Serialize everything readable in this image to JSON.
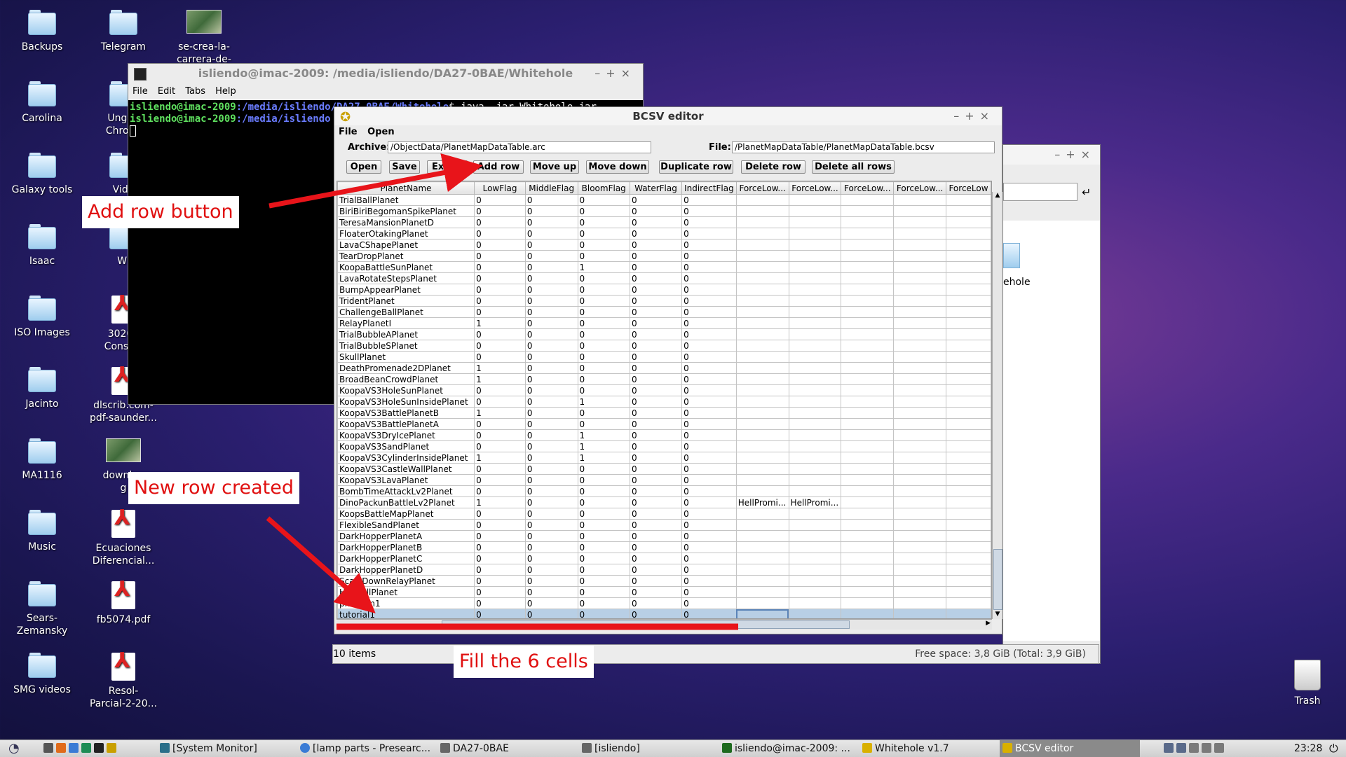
{
  "desktop": {
    "icons_col1": [
      {
        "label": "Backups",
        "kind": "folder"
      },
      {
        "label": "Carolina",
        "kind": "folder"
      },
      {
        "label": "Galaxy tools",
        "kind": "folder"
      },
      {
        "label": "Isaac",
        "kind": "folder"
      },
      {
        "label": "ISO Images",
        "kind": "folder"
      },
      {
        "label": "Jacinto",
        "kind": "folder"
      },
      {
        "label": "MA1116",
        "kind": "folder"
      },
      {
        "label": "Music",
        "kind": "folder"
      },
      {
        "label": "Sears-\nZemansky",
        "kind": "folder"
      },
      {
        "label": "SMG videos",
        "kind": "folder"
      }
    ],
    "icons_col2": [
      {
        "label": "Telegram",
        "kind": "folder"
      },
      {
        "label": "Ungoo\nChromi",
        "kind": "folder"
      },
      {
        "label": "Vide",
        "kind": "folder"
      },
      {
        "label": "Wi",
        "kind": "folder"
      },
      {
        "label": "30209\nConstru",
        "kind": "pdf"
      },
      {
        "label": "dlscrib.com-\npdf-saunder...",
        "kind": "pdf"
      },
      {
        "label": "downloa\ng",
        "kind": "image"
      },
      {
        "label": "Ecuaciones\nDiferencial...",
        "kind": "pdf"
      },
      {
        "label": "fb5074.pdf",
        "kind": "pdf"
      },
      {
        "label": "Resol-\nParcial-2-20...",
        "kind": "pdf"
      }
    ],
    "icons_col3": [
      {
        "label": "se-crea-la-\ncarrera-de-",
        "kind": "image"
      }
    ],
    "trash_label": "Trash"
  },
  "terminal": {
    "title": "isliendo@imac-2009: /media/isliendo/DA27-0BAE/Whitehole",
    "menu": [
      "File",
      "Edit",
      "Tabs",
      "Help"
    ],
    "line1_user": "isliendo@imac-2009",
    "line1_path": ":/media/isliendo/DA27-0BAE/Whitehole",
    "line1_cmd": "$ java -jar Whitehole.jar",
    "line2_user": "isliendo@imac-2009",
    "line2_path": ":/media/isliendo"
  },
  "filemanager": {
    "folder_label": "ehole",
    "status_left": "10 items",
    "status_right": "Free space: 3,8 GiB (Total: 3,9 GiB)"
  },
  "bcsv": {
    "title": "BCSV editor",
    "menu": [
      "File",
      "Open"
    ],
    "archive_label": "Archive:",
    "archive_value": "/ObjectData/PlanetMapDataTable.arc",
    "file_label": "File:",
    "file_value": "/PlanetMapDataTable/PlanetMapDataTable.bcsv",
    "buttons": {
      "open": "Open",
      "save": "Save",
      "export": "Exp",
      "add_row": "Add row",
      "move_up": "Move up",
      "move_down": "Move down",
      "duplicate_row": "Duplicate row",
      "delete_row": "Delete row",
      "delete_all_rows": "Delete all rows"
    },
    "columns": [
      "PlanetName",
      "LowFlag",
      "MiddleFlag",
      "BloomFlag",
      "WaterFlag",
      "IndirectFlag",
      "ForceLow...",
      "ForceLow...",
      "ForceLow...",
      "ForceLow...",
      "ForceLow"
    ],
    "rows": [
      [
        "TrialBallPlanet",
        "0",
        "0",
        "0",
        "0",
        "0",
        "",
        "",
        "",
        "",
        ""
      ],
      [
        "BiriBiriBegomanSpikePlanet",
        "0",
        "0",
        "0",
        "0",
        "0",
        "",
        "",
        "",
        "",
        ""
      ],
      [
        "TeresaMansionPlanetD",
        "0",
        "0",
        "0",
        "0",
        "0",
        "",
        "",
        "",
        "",
        ""
      ],
      [
        "FloaterOtakingPlanet",
        "0",
        "0",
        "0",
        "0",
        "0",
        "",
        "",
        "",
        "",
        ""
      ],
      [
        "LavaCShapePlanet",
        "0",
        "0",
        "0",
        "0",
        "0",
        "",
        "",
        "",
        "",
        ""
      ],
      [
        "TearDropPlanet",
        "0",
        "0",
        "0",
        "0",
        "0",
        "",
        "",
        "",
        "",
        ""
      ],
      [
        "KoopaBattleSunPlanet",
        "0",
        "0",
        "1",
        "0",
        "0",
        "",
        "",
        "",
        "",
        ""
      ],
      [
        "LavaRotateStepsPlanet",
        "0",
        "0",
        "0",
        "0",
        "0",
        "",
        "",
        "",
        "",
        ""
      ],
      [
        "BumpAppearPlanet",
        "0",
        "0",
        "0",
        "0",
        "0",
        "",
        "",
        "",
        "",
        ""
      ],
      [
        "TridentPlanet",
        "0",
        "0",
        "0",
        "0",
        "0",
        "",
        "",
        "",
        "",
        ""
      ],
      [
        "ChallengeBallPlanet",
        "0",
        "0",
        "0",
        "0",
        "0",
        "",
        "",
        "",
        "",
        ""
      ],
      [
        "RelayPlanetI",
        "1",
        "0",
        "0",
        "0",
        "0",
        "",
        "",
        "",
        "",
        ""
      ],
      [
        "TrialBubbleAPlanet",
        "0",
        "0",
        "0",
        "0",
        "0",
        "",
        "",
        "",
        "",
        ""
      ],
      [
        "TrialBubbleSPlanet",
        "0",
        "0",
        "0",
        "0",
        "0",
        "",
        "",
        "",
        "",
        ""
      ],
      [
        "SkullPlanet",
        "0",
        "0",
        "0",
        "0",
        "0",
        "",
        "",
        "",
        "",
        ""
      ],
      [
        "DeathPromenade2DPlanet",
        "1",
        "0",
        "0",
        "0",
        "0",
        "",
        "",
        "",
        "",
        ""
      ],
      [
        "BroadBeanCrowdPlanet",
        "1",
        "0",
        "0",
        "0",
        "0",
        "",
        "",
        "",
        "",
        ""
      ],
      [
        "KoopaVS3HoleSunPlanet",
        "0",
        "0",
        "0",
        "0",
        "0",
        "",
        "",
        "",
        "",
        ""
      ],
      [
        "KoopaVS3HoleSunInsidePlanet",
        "0",
        "0",
        "1",
        "0",
        "0",
        "",
        "",
        "",
        "",
        ""
      ],
      [
        "KoopaVS3BattlePlanetB",
        "1",
        "0",
        "0",
        "0",
        "0",
        "",
        "",
        "",
        "",
        ""
      ],
      [
        "KoopaVS3BattlePlanetA",
        "0",
        "0",
        "0",
        "0",
        "0",
        "",
        "",
        "",
        "",
        ""
      ],
      [
        "KoopaVS3DryIcePlanet",
        "0",
        "0",
        "1",
        "0",
        "0",
        "",
        "",
        "",
        "",
        ""
      ],
      [
        "KoopaVS3SandPlanet",
        "0",
        "0",
        "1",
        "0",
        "0",
        "",
        "",
        "",
        "",
        ""
      ],
      [
        "KoopaVS3CylinderInsidePlanet",
        "1",
        "0",
        "1",
        "0",
        "0",
        "",
        "",
        "",
        "",
        ""
      ],
      [
        "KoopaVS3CastleWallPlanet",
        "0",
        "0",
        "0",
        "0",
        "0",
        "",
        "",
        "",
        "",
        ""
      ],
      [
        "KoopaVS3LavaPlanet",
        "0",
        "0",
        "0",
        "0",
        "0",
        "",
        "",
        "",
        "",
        ""
      ],
      [
        "BombTimeAttackLv2Planet",
        "0",
        "0",
        "0",
        "0",
        "0",
        "",
        "",
        "",
        "",
        ""
      ],
      [
        "DinoPackunBattleLv2Planet",
        "1",
        "0",
        "0",
        "0",
        "0",
        "HellPromi...",
        "HellPromi...",
        "",
        "",
        ""
      ],
      [
        "KoopsBattleMapPlanet",
        "0",
        "0",
        "0",
        "0",
        "0",
        "",
        "",
        "",
        "",
        ""
      ],
      [
        "FlexibleSandPlanet",
        "0",
        "0",
        "0",
        "0",
        "0",
        "",
        "",
        "",
        "",
        ""
      ],
      [
        "DarkHopperPlanetA",
        "0",
        "0",
        "0",
        "0",
        "0",
        "",
        "",
        "",
        "",
        ""
      ],
      [
        "DarkHopperPlanetB",
        "0",
        "0",
        "0",
        "0",
        "0",
        "",
        "",
        "",
        "",
        ""
      ],
      [
        "DarkHopperPlanetC",
        "0",
        "0",
        "0",
        "0",
        "0",
        "",
        "",
        "",
        "",
        ""
      ],
      [
        "DarkHopperPlanetD",
        "0",
        "0",
        "0",
        "0",
        "0",
        "",
        "",
        "",
        "",
        ""
      ],
      [
        "ScaleDownRelayPlanet",
        "0",
        "0",
        "0",
        "0",
        "0",
        "",
        "",
        "",
        "",
        ""
      ],
      [
        "HellBallPlanet",
        "0",
        "0",
        "0",
        "0",
        "0",
        "",
        "",
        "",
        "",
        ""
      ],
      [
        "platform1",
        "0",
        "0",
        "0",
        "0",
        "0",
        "",
        "",
        "",
        "",
        ""
      ],
      [
        "tutorial1",
        "0",
        "0",
        "0",
        "0",
        "0",
        "",
        "",
        "",
        "",
        ""
      ]
    ]
  },
  "callouts": {
    "add_row": "Add row button",
    "new_row": "New row created",
    "fill": "Fill the 6 cells"
  },
  "taskbar": {
    "tasks": [
      "[System Monitor]",
      "[lamp parts - Presearc...",
      "DA27-0BAE",
      "[isliendo]",
      "isliendo@imac-2009: ...",
      "Whitehole v1.7",
      "BCSV editor"
    ],
    "clock": "23:28"
  },
  "colors": {
    "callout_text": "#e01010",
    "arrow": "#e8141a",
    "selection": "#b8cfe5"
  }
}
